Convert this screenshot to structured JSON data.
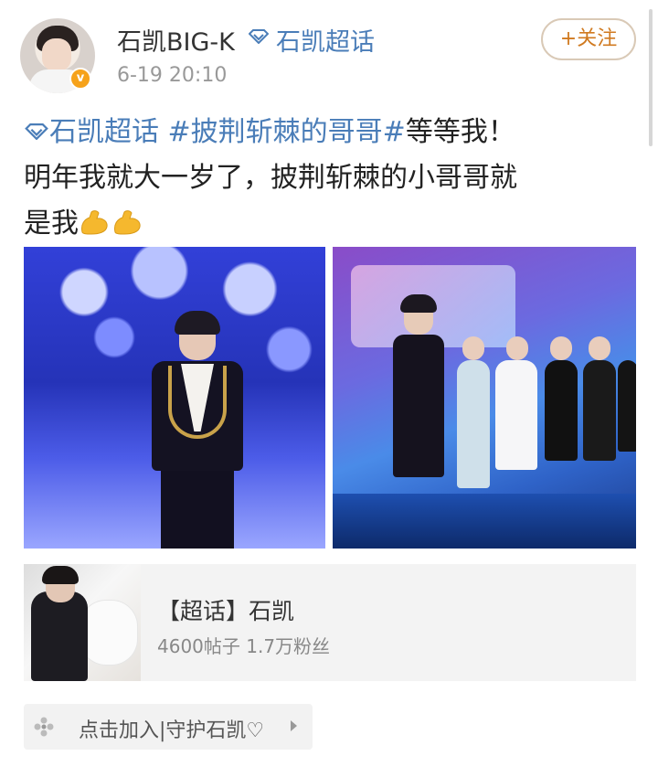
{
  "header": {
    "username": "石凯BIG-K",
    "channel_link": "石凯超话",
    "timestamp": "6-19 20:10",
    "follow_label": "+关注",
    "verified_badge": "v"
  },
  "post": {
    "channel_tag": "石凯超话",
    "hashtag": "#披荆斩棘的哥哥#",
    "text_line1_rest": "等等我！",
    "text_line2": "明年我就大一岁了，披荆斩棘的小哥哥就",
    "text_line3": "是我",
    "emoji": "muscle-icon"
  },
  "photos": [
    "stage-photo-1",
    "stage-photo-2"
  ],
  "super_topic_card": {
    "title": "【超话】石凯",
    "stats": "4600帖子 1.7万粉丝"
  },
  "join_button": {
    "label": "点击加入|守护石凯♡"
  },
  "colors": {
    "link": "#4a7db8",
    "follow": "#d07a20",
    "follow_border": "#d9c9b6",
    "gray_text": "#999999",
    "badge": "#f6a21a"
  }
}
